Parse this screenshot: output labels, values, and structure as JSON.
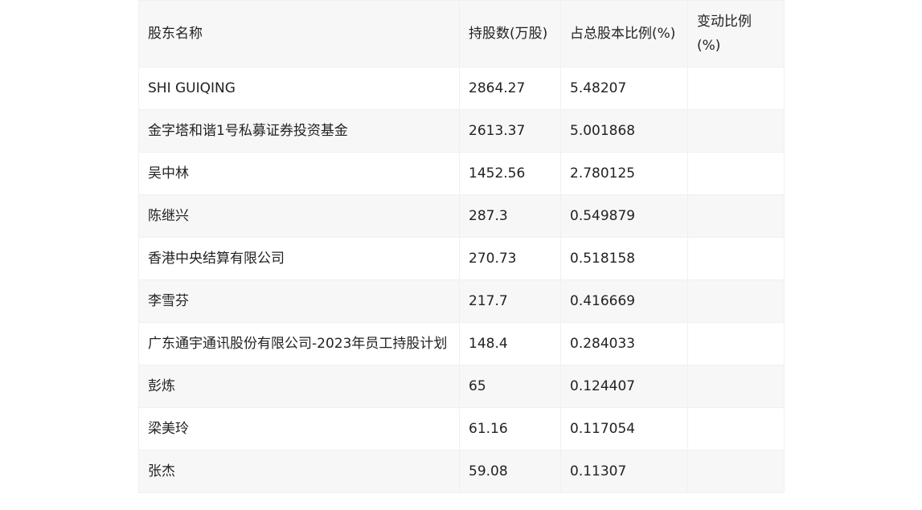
{
  "table": {
    "headers": [
      "股东名称",
      "持股数(万股)",
      "占总股本比例(%)",
      "变动比例(%)"
    ],
    "rows": [
      [
        "SHI GUIQING",
        "2864.27",
        "5.48207",
        ""
      ],
      [
        "金字塔和谐1号私募证券投资基金",
        "2613.37",
        "5.001868",
        ""
      ],
      [
        "吴中林",
        "1452.56",
        "2.780125",
        ""
      ],
      [
        "陈继兴",
        "287.3",
        "0.549879",
        ""
      ],
      [
        "香港中央结算有限公司",
        "270.73",
        "0.518158",
        ""
      ],
      [
        "李雪芬",
        "217.7",
        "0.416669",
        ""
      ],
      [
        "广东通宇通讯股份有限公司-2023年员工持股计划",
        "148.4",
        "0.284033",
        ""
      ],
      [
        "彭炼",
        "65",
        "0.124407",
        ""
      ],
      [
        "梁美玲",
        "61.16",
        "0.117054",
        ""
      ],
      [
        "张杰",
        "59.08",
        "0.11307",
        ""
      ]
    ]
  }
}
